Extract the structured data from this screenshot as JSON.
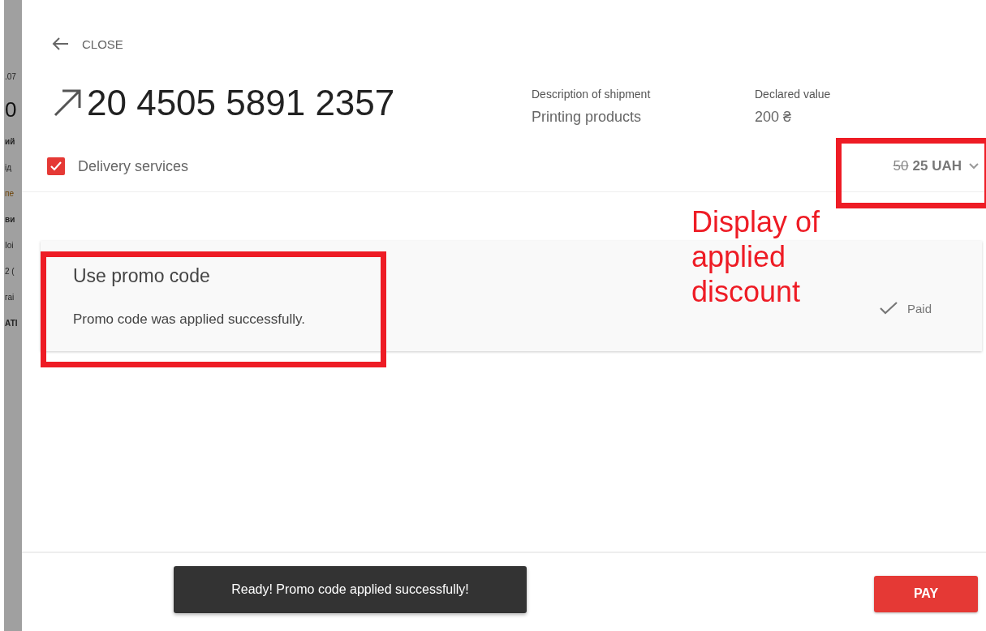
{
  "background_page": {
    "fragments": [
      {
        "text": ".07",
        "kind": "small"
      },
      {
        "text": "0",
        "kind": "large"
      },
      {
        "text": "ий",
        "kind": "bold"
      },
      {
        "text": "ід",
        "kind": "small"
      },
      {
        "text": "пе",
        "kind": "accent"
      },
      {
        "text": "ви",
        "kind": "bold"
      },
      {
        "text": "Іоі",
        "kind": "small"
      },
      {
        "text": "2 (",
        "kind": "small"
      },
      {
        "text": "гаі",
        "kind": "small"
      },
      {
        "text": "АТІ",
        "kind": "bold"
      }
    ]
  },
  "panel": {
    "close_label": "CLOSE",
    "tracking_number": "20 4505 5891 2357",
    "info": [
      {
        "label": "Description of shipment",
        "value": "Printing products"
      },
      {
        "label": "Declared value",
        "value": "200 ₴"
      }
    ],
    "delivery": {
      "label": "Delivery services",
      "checked": true,
      "old_price": "50",
      "price": "25 UAH"
    },
    "promo": {
      "title": "Use promo code",
      "message": "Promo code was applied successfully.",
      "status": "Paid"
    },
    "toast": "Ready! Promo code applied successfully!",
    "pay_button": "PAY"
  },
  "annotations": {
    "note": "Display of applied discount"
  }
}
